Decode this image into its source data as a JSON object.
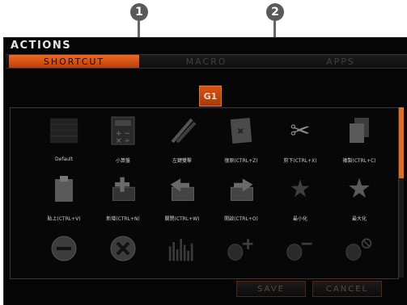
{
  "callouts": [
    "1",
    "2"
  ],
  "window": {
    "title": "ACTIONS"
  },
  "tabs": [
    {
      "label": "SHORTCUT",
      "active": true
    },
    {
      "label": "MACRO",
      "active": false
    },
    {
      "label": "APPS",
      "active": false
    }
  ],
  "macro_key": "G1",
  "actions": [
    {
      "label": "Default",
      "icon": "keyboard-icon"
    },
    {
      "label": "小算盤",
      "icon": "calculator-icon"
    },
    {
      "label": "左鍵雙擊",
      "icon": "pencil-icon"
    },
    {
      "label": "復原(CTRL+Z)",
      "icon": "undo-icon"
    },
    {
      "label": "剪下(CTRL+X)",
      "icon": "scissors-icon"
    },
    {
      "label": "複製(CTRL+C)",
      "icon": "copy-icon"
    },
    {
      "label": "貼上(CTRL+V)",
      "icon": "paste-icon"
    },
    {
      "label": "新增(CTRL+N)",
      "icon": "new-box-icon"
    },
    {
      "label": "關閉(CTRL+W)",
      "icon": "close-box-icon"
    },
    {
      "label": "開啟(CTRL+O)",
      "icon": "open-box-icon"
    },
    {
      "label": "最小化",
      "icon": "minimize-star-icon"
    },
    {
      "label": "最大化",
      "icon": "maximize-star-icon"
    },
    {
      "label": "",
      "icon": "volume-minus-icon"
    },
    {
      "label": "",
      "icon": "volume-x-icon"
    },
    {
      "label": "",
      "icon": "equalizer-icon"
    },
    {
      "label": "",
      "icon": "speaker-up-icon"
    },
    {
      "label": "",
      "icon": "speaker-down-icon"
    },
    {
      "label": "",
      "icon": "speaker-mute-icon"
    }
  ],
  "buttons": {
    "save": "SAVE",
    "cancel": "CANCEL"
  },
  "colors": {
    "accent": "#e86a1f",
    "background": "#050505"
  }
}
